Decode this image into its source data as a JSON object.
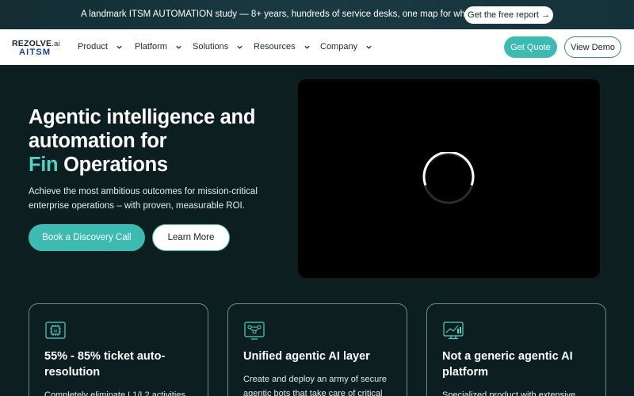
{
  "banner": {
    "text": "A landmark ITSM AUTOMATION study — 8+ years, hundreds of service desks, one map for where AI pays off first.",
    "cta": "Get the free report →"
  },
  "nav": {
    "logo_top": "REZOLVE",
    "logo_ai": ".ai",
    "logo_bottom": "AITSM",
    "items": [
      {
        "label": "Product",
        "icon": "chevron-down-icon"
      },
      {
        "label": "Platform",
        "icon": "chevron-down-icon"
      },
      {
        "label": "Solutions",
        "icon": "chevron-down-icon"
      },
      {
        "label": "Resources",
        "icon": "chevron-down-icon"
      },
      {
        "label": "Company",
        "icon": "chevron-down-icon"
      }
    ],
    "quote_label": "Get Quote",
    "demo_label": "View Demo"
  },
  "hero": {
    "title_line1": "Agentic intelligence and",
    "title_line2": "automation for",
    "title_accent": "Fin",
    "title_line3": "Operations",
    "subtitle": "Achieve the most ambitious outcomes for mission-critical enterprise operations – with proven, measurable ROI.",
    "primary_cta": "Book a Discovery Call",
    "secondary_cta": "Learn More"
  },
  "video": {
    "state": "loading",
    "icon": "loading-spinner-icon"
  },
  "cards": [
    {
      "icon": "ai-chip-icon",
      "title": "55% - 85% ticket auto-resolution",
      "desc": "Completely eliminate L1/L2 activities"
    },
    {
      "icon": "agent-network-icon",
      "title": "Unified agentic AI layer",
      "desc": "Create and deploy an army of secure agentic bots that take care of critical"
    },
    {
      "icon": "analytics-monitor-icon",
      "title": "Not a generic agentic AI platform",
      "desc": "Specialized product with extensive"
    }
  ],
  "colors": {
    "accent": "#3dbbb2",
    "accent_text": "#4fd1c5",
    "background": "#0c1e1f",
    "brand_blue": "#1b3f9e"
  }
}
